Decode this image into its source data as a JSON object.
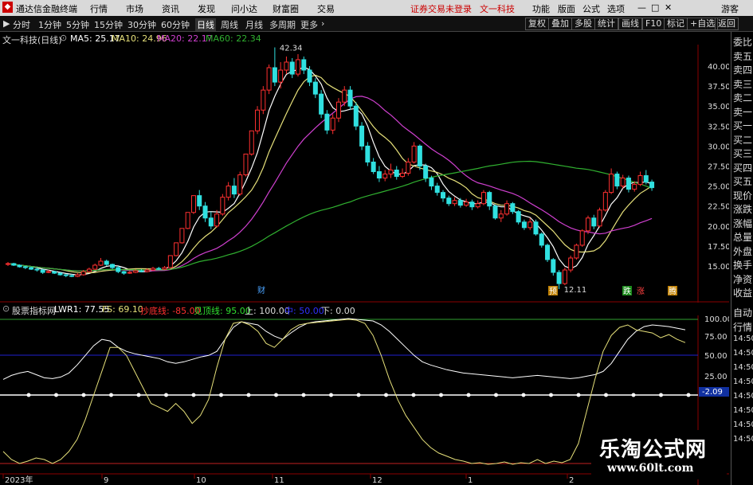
{
  "menubar": {
    "app_title": "通达信金融终端",
    "menus": [
      "行情",
      "市场",
      "资讯",
      "发现",
      "问小达",
      "财富圈",
      "交易"
    ],
    "login_notice": "证券交易未登录",
    "stock_name": "文一科技",
    "right_menus": [
      "功能",
      "版面",
      "公式",
      "选项"
    ],
    "guest": "游客"
  },
  "toolbar": {
    "periods": [
      "分时",
      "1分钟",
      "5分钟",
      "15分钟",
      "30分钟",
      "60分钟",
      "日线",
      "周线",
      "月线",
      "多周期",
      "更多"
    ],
    "active_period": "日线",
    "right_buttons": [
      "复权",
      "叠加",
      "多股",
      "统计",
      "画线",
      "F10",
      "标记",
      "+自选",
      "返回"
    ]
  },
  "main_legend": {
    "title": "文一科技(日线)",
    "ma5": "MA5: 25.17",
    "ma10": "MA10: 24.96",
    "ma20": "MA20: 22.17",
    "ma60": "MA60: 22.34"
  },
  "price_axis": {
    "labels": [
      "40.00",
      "37.50",
      "35.00",
      "32.50",
      "30.00",
      "27.50",
      "25.00",
      "22.50",
      "20.00",
      "17.50",
      "15.00"
    ],
    "high_label": "42.34",
    "low_label": "12.11"
  },
  "event_markers": {
    "cai": "财",
    "yu": "预",
    "die": "跌",
    "zhang": "涨",
    "teng": "腾"
  },
  "side_panel": [
    "委比",
    "卖五",
    "卖四",
    "卖三",
    "卖二",
    "卖一",
    "买一",
    "买二",
    "买三",
    "买四",
    "买五",
    "现价",
    "涨跌",
    "涨幅",
    "总量",
    "外盘",
    "换手",
    "净资",
    "收益"
  ],
  "indicator_legend": {
    "name": "股票指标网",
    "lwr1": "LWR1: 77.55",
    "fs": "FS: 69.10",
    "chaodi": "抄底线: -85.00",
    "jianding": "见顶线: 95.00",
    "shang": "上: 100.00",
    "zhong": "中: 50.00",
    "xia": "下: 0.00"
  },
  "indicator_axis": {
    "labels": [
      "100.00",
      "75.00",
      "50.00",
      "25.00"
    ],
    "current": "-2.09"
  },
  "side_panel2": [
    "自动",
    "行情",
    "14:50",
    "14:50",
    "14:50",
    "14:50",
    "14:50",
    "14:50",
    "14:50",
    "14:50"
  ],
  "x_axis": [
    "2023年",
    "9",
    "10",
    "11",
    "12",
    "1",
    "2"
  ],
  "watermark": {
    "title": "乐淘公式网",
    "url": "www.60lt.com"
  },
  "colors": {
    "ma5": "#ffffff",
    "ma10": "#e6e07a",
    "ma20": "#d040d0",
    "ma60": "#30b030",
    "up": "#ff3030",
    "down": "#30e0e0",
    "grid": "#8b0000"
  },
  "chart_data": {
    "type": "candlestick",
    "ylim": [
      12,
      44
    ],
    "candles": [
      [
        15.2,
        15.3,
        15.5,
        15.0
      ],
      [
        15.3,
        15.1,
        15.4,
        15.0
      ],
      [
        15.1,
        14.9,
        15.2,
        14.8
      ],
      [
        14.9,
        14.8,
        15.0,
        14.6
      ],
      [
        14.8,
        14.6,
        14.9,
        14.5
      ],
      [
        14.6,
        14.5,
        14.8,
        14.3
      ],
      [
        14.5,
        14.2,
        14.6,
        14.0
      ],
      [
        14.2,
        14.3,
        14.5,
        14.1
      ],
      [
        14.3,
        14.1,
        14.4,
        14.0
      ],
      [
        14.1,
        13.9,
        14.2,
        13.8
      ],
      [
        13.9,
        13.8,
        14.0,
        13.6
      ],
      [
        13.8,
        13.7,
        14.0,
        13.6
      ],
      [
        13.7,
        13.9,
        14.1,
        13.6
      ],
      [
        13.9,
        14.3,
        14.5,
        13.8
      ],
      [
        14.3,
        14.6,
        14.8,
        14.2
      ],
      [
        14.6,
        15.1,
        15.3,
        14.5
      ],
      [
        15.1,
        15.6,
        16.0,
        15.0
      ],
      [
        15.6,
        15.2,
        15.8,
        15.0
      ],
      [
        15.2,
        14.8,
        15.3,
        14.6
      ],
      [
        14.8,
        14.3,
        15.0,
        14.1
      ],
      [
        14.3,
        14.1,
        14.4,
        13.9
      ],
      [
        14.1,
        14.2,
        14.4,
        14.0
      ],
      [
        14.2,
        14.4,
        14.6,
        14.1
      ],
      [
        14.4,
        14.3,
        14.6,
        14.2
      ],
      [
        14.3,
        14.5,
        14.7,
        14.2
      ],
      [
        14.5,
        14.7,
        14.9,
        14.4
      ],
      [
        14.7,
        14.6,
        14.9,
        14.5
      ],
      [
        14.6,
        14.8,
        15.0,
        14.5
      ],
      [
        14.8,
        16.3,
        16.3,
        14.8
      ],
      [
        16.3,
        17.9,
        17.9,
        16.2
      ],
      [
        17.9,
        19.7,
        19.7,
        17.8
      ],
      [
        19.7,
        21.7,
        21.7,
        19.6
      ],
      [
        21.7,
        23.8,
        23.8,
        21.5
      ],
      [
        23.8,
        22.5,
        24.5,
        22.0
      ],
      [
        22.5,
        21.0,
        23.0,
        20.5
      ],
      [
        21.0,
        20.0,
        21.8,
        19.6
      ],
      [
        20.0,
        21.5,
        22.0,
        19.8
      ],
      [
        21.5,
        23.6,
        24.0,
        21.3
      ],
      [
        23.6,
        25.0,
        25.5,
        23.2
      ],
      [
        25.0,
        24.0,
        26.0,
        23.5
      ],
      [
        24.0,
        26.4,
        26.8,
        23.8
      ],
      [
        26.4,
        29.0,
        29.0,
        26.2
      ],
      [
        29.0,
        31.9,
        31.9,
        28.8
      ],
      [
        31.9,
        34.5,
        35.0,
        31.5
      ],
      [
        34.5,
        37.0,
        37.5,
        34.0
      ],
      [
        37.0,
        39.8,
        40.2,
        36.5
      ],
      [
        39.8,
        38.0,
        42.34,
        37.5
      ],
      [
        38.0,
        39.5,
        40.5,
        37.2
      ],
      [
        39.5,
        40.5,
        41.2,
        39.0
      ],
      [
        40.5,
        39.0,
        41.0,
        38.5
      ],
      [
        39.0,
        40.8,
        41.5,
        38.7
      ],
      [
        40.8,
        39.5,
        41.2,
        39.0
      ],
      [
        39.5,
        38.0,
        40.0,
        37.5
      ],
      [
        38.0,
        36.5,
        38.5,
        36.0
      ],
      [
        36.5,
        34.0,
        37.0,
        33.5
      ],
      [
        34.0,
        32.0,
        34.5,
        31.5
      ],
      [
        32.0,
        33.5,
        34.0,
        31.5
      ],
      [
        33.5,
        35.5,
        36.0,
        33.0
      ],
      [
        35.5,
        37.0,
        37.5,
        35.0
      ],
      [
        37.0,
        35.0,
        37.5,
        34.5
      ],
      [
        35.0,
        32.5,
        35.5,
        32.0
      ],
      [
        32.5,
        30.0,
        33.0,
        29.5
      ],
      [
        30.0,
        28.0,
        30.5,
        27.5
      ],
      [
        28.0,
        26.8,
        28.5,
        26.5
      ],
      [
        26.8,
        26.0,
        27.5,
        25.5
      ],
      [
        26.0,
        26.5,
        27.0,
        25.6
      ],
      [
        26.5,
        27.0,
        27.8,
        26.0
      ],
      [
        27.0,
        26.2,
        27.5,
        25.8
      ],
      [
        26.2,
        26.6,
        27.2,
        26.0
      ],
      [
        26.6,
        28.0,
        28.5,
        26.3
      ],
      [
        28.0,
        30.0,
        30.5,
        27.8
      ],
      [
        30.0,
        27.5,
        30.2,
        27.0
      ],
      [
        27.5,
        26.0,
        27.8,
        25.5
      ],
      [
        26.0,
        25.0,
        26.3,
        24.5
      ],
      [
        25.0,
        24.2,
        25.4,
        23.8
      ],
      [
        24.2,
        23.5,
        24.5,
        23.0
      ],
      [
        23.5,
        22.8,
        23.8,
        22.5
      ],
      [
        22.8,
        23.2,
        23.6,
        22.5
      ],
      [
        23.2,
        22.6,
        23.5,
        22.3
      ],
      [
        22.6,
        23.0,
        23.4,
        22.4
      ],
      [
        23.0,
        22.4,
        23.3,
        22.0
      ],
      [
        22.4,
        22.8,
        23.2,
        22.2
      ],
      [
        22.8,
        24.2,
        24.5,
        22.6
      ],
      [
        24.2,
        22.5,
        24.4,
        22.0
      ],
      [
        22.5,
        21.0,
        22.7,
        20.8
      ],
      [
        21.0,
        21.5,
        22.0,
        20.5
      ],
      [
        21.5,
        22.8,
        23.2,
        21.3
      ],
      [
        22.8,
        21.8,
        23.0,
        21.5
      ],
      [
        21.8,
        20.5,
        22.0,
        20.2
      ],
      [
        20.5,
        19.8,
        20.8,
        19.5
      ],
      [
        19.8,
        20.5,
        21.0,
        19.5
      ],
      [
        20.5,
        19.0,
        20.8,
        18.8
      ],
      [
        19.0,
        17.6,
        19.2,
        17.3
      ],
      [
        17.6,
        15.8,
        17.8,
        15.5
      ],
      [
        15.8,
        14.2,
        16.0,
        13.8
      ],
      [
        14.2,
        12.8,
        14.5,
        12.11
      ],
      [
        12.8,
        14.5,
        14.8,
        12.6
      ],
      [
        14.5,
        16.0,
        16.3,
        14.2
      ],
      [
        16.0,
        17.6,
        17.8,
        15.8
      ],
      [
        17.6,
        19.4,
        19.6,
        17.4
      ],
      [
        19.4,
        21.0,
        21.3,
        19.0
      ],
      [
        21.0,
        20.0,
        21.4,
        19.6
      ],
      [
        20.0,
        22.0,
        22.3,
        19.8
      ],
      [
        22.0,
        24.2,
        24.5,
        21.8
      ],
      [
        24.2,
        26.5,
        27.2,
        24.0
      ],
      [
        26.5,
        25.0,
        26.8,
        24.6
      ],
      [
        25.0,
        26.0,
        26.4,
        24.7
      ],
      [
        26.0,
        24.6,
        26.3,
        24.2
      ],
      [
        24.6,
        25.2,
        25.6,
        24.3
      ],
      [
        25.2,
        26.3,
        26.8,
        25.0
      ],
      [
        26.3,
        25.5,
        27.0,
        25.2
      ],
      [
        25.5,
        24.8,
        25.8,
        24.4
      ]
    ]
  }
}
